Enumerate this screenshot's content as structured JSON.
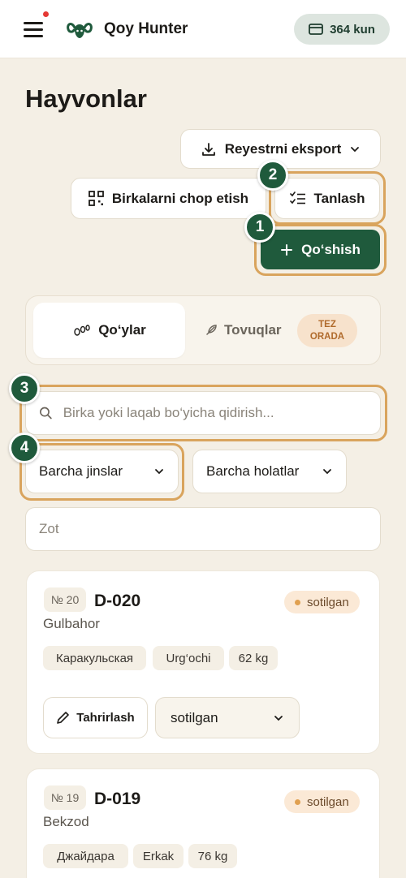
{
  "header": {
    "app_title": "Qoy Hunter",
    "balance": "364 kun",
    "menu_icon": "hamburger-menu-icon",
    "logo_icon": "ram-head-logo-icon",
    "accent_color": "#1f5a3c",
    "notification_dot_color": "#e53935"
  },
  "page": {
    "title": "Hayvonlar"
  },
  "actions": {
    "export_label": "Reyestrni eksport",
    "print_tags_label": "Birkalarni chop etish",
    "select_label": "Tanlash",
    "add_label": "Qo‘shish"
  },
  "guide_badges": [
    "1",
    "2",
    "3",
    "4"
  ],
  "tabs": {
    "sheep": "Qo‘ylar",
    "chickens": "Tovuqlar",
    "soon_line1": "TEZ",
    "soon_line2": "ORADA"
  },
  "filters": {
    "search_placeholder": "Birka yoki laqab bo‘yicha qidirish...",
    "sex_value": "Barcha jinslar",
    "status_value": "Barcha holatlar",
    "breed_placeholder": "Zot"
  },
  "animals": [
    {
      "number": "№ 20",
      "tag": "D-020",
      "nickname": "Gulbahor",
      "status": "sotilgan",
      "breed": "Каракульская",
      "sex": "Urg‘ochi",
      "weight": "62 kg",
      "edit_label": "Tahrirlash",
      "status_select": "sotilgan"
    },
    {
      "number": "№ 19",
      "tag": "D-019",
      "nickname": "Bekzod",
      "status": "sotilgan",
      "breed": "Джайдара",
      "sex": "Erkak",
      "weight": "76 kg"
    }
  ]
}
